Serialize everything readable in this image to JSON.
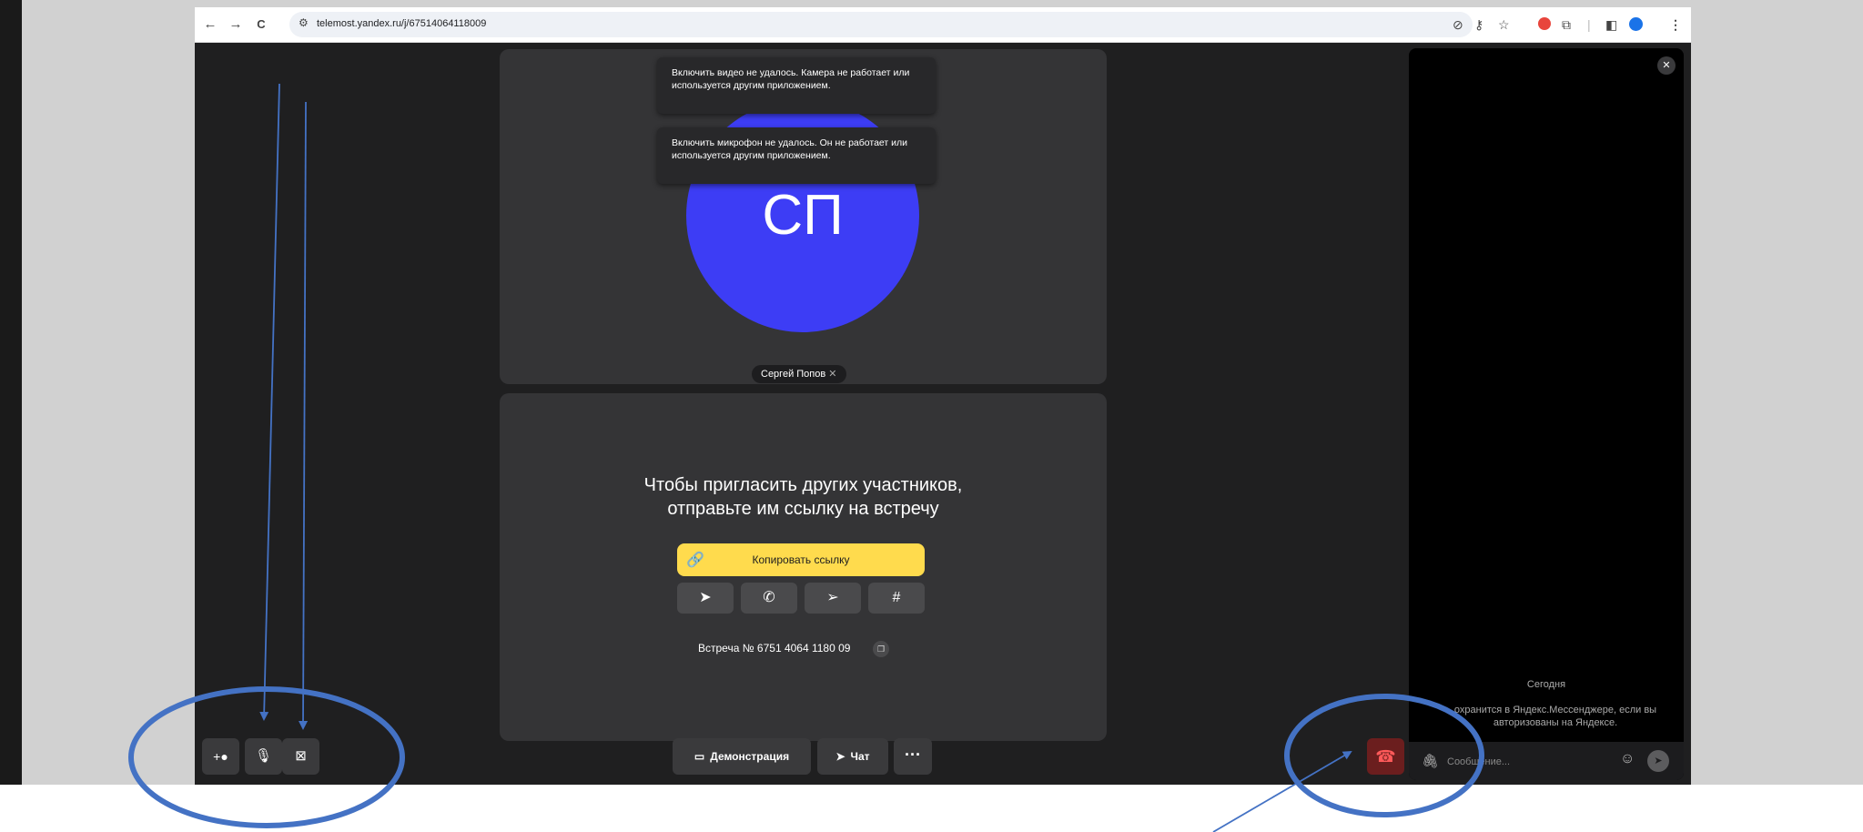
{
  "browser": {
    "back_icon": "←",
    "forward_icon": "→",
    "reload_icon": "C",
    "url": "telemost.yandex.ru/j/67514064118009",
    "right_icons": [
      "camera-blocked-icon",
      "key-icon",
      "star-icon",
      "extension-red-icon",
      "puzzle-icon",
      "sidebar-icon",
      "profile-icon",
      "menu-icon"
    ]
  },
  "toasts": {
    "video": "Включить видео не удалось. Камера не работает или используется другим приложением.",
    "mic": "Включить микрофон не удалось. Он не работает или используется другим приложением."
  },
  "participant": {
    "initials": "СП",
    "name": "Сергей Попов"
  },
  "invite": {
    "line1": "Чтобы пригласить других участников,",
    "line2": "отправьте им ссылку на встречу",
    "copy_button": "Копировать ссылку",
    "share_icons": [
      "telegram-icon",
      "whatsapp-icon",
      "send-icon",
      "slack-icon"
    ],
    "meeting_number": "Встреча № 6751 4064 1180 09"
  },
  "controls": {
    "demo_label": "Демонстрация",
    "chat_label": "Чат",
    "more_label": "···"
  },
  "chat": {
    "date": "Сегодня",
    "notice": "охранится в Яндекс.Мессенджере, если вы авторизованы на Яндексе.",
    "placeholder": "Сообщение..."
  },
  "colors": {
    "avatar": "#3d3df5",
    "copy_button": "#ffdb4d",
    "hangup": "#6b1e1e",
    "annotation": "#4472c4"
  }
}
